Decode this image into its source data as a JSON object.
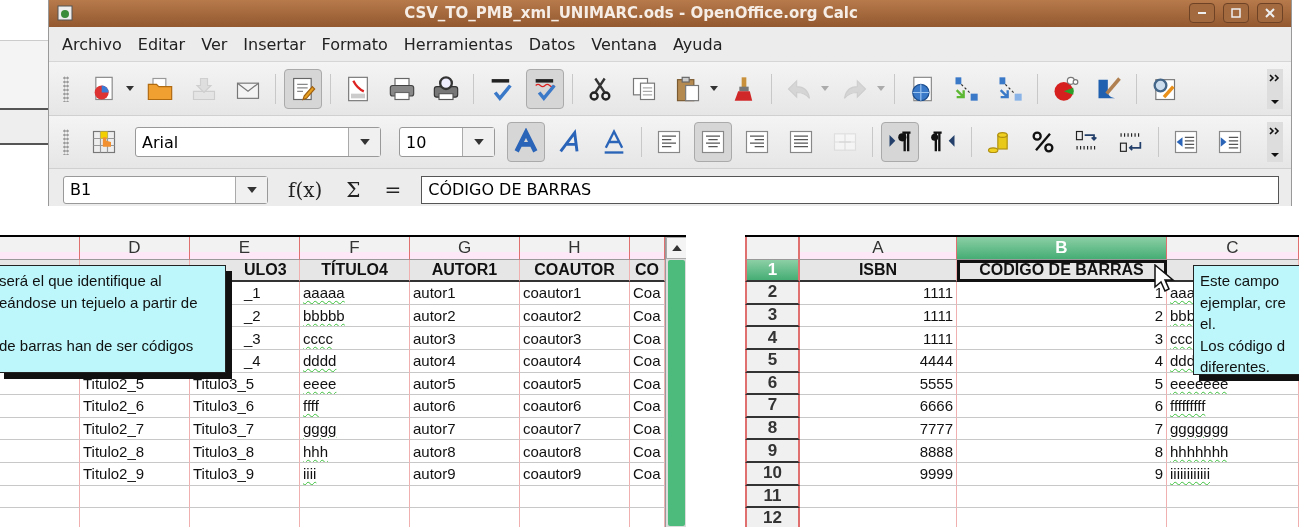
{
  "window": {
    "title": "CSV_TO_PMB_xml_UNIMARC.ods - OpenOffice.org Calc"
  },
  "menu": [
    "Archivo",
    "Editar",
    "Ver",
    "Insertar",
    "Formato",
    "Herramientas",
    "Datos",
    "Ventana",
    "Ayuda"
  ],
  "toolbar_standard": {
    "groups": [
      [
        {
          "kind": "new",
          "pressed": false,
          "disabled": false
        },
        {
          "kind": "dropdown",
          "pressed": false,
          "disabled": false
        },
        {
          "kind": "open",
          "pressed": false,
          "disabled": false
        },
        {
          "kind": "save",
          "pressed": false,
          "disabled": true
        },
        {
          "kind": "email",
          "pressed": false,
          "disabled": false
        }
      ],
      [
        {
          "kind": "edit",
          "pressed": true,
          "disabled": false
        }
      ],
      [
        {
          "kind": "pdf",
          "pressed": false,
          "disabled": false
        },
        {
          "kind": "print",
          "pressed": false,
          "disabled": false
        },
        {
          "kind": "preview",
          "pressed": false,
          "disabled": false
        }
      ],
      [
        {
          "kind": "spellcheck",
          "pressed": false,
          "disabled": false
        },
        {
          "kind": "autospell",
          "pressed": true,
          "disabled": false
        }
      ],
      [
        {
          "kind": "cut",
          "pressed": false,
          "disabled": false
        },
        {
          "kind": "copy",
          "pressed": false,
          "disabled": false
        },
        {
          "kind": "paste",
          "pressed": false,
          "disabled": false
        },
        {
          "kind": "dropdown",
          "pressed": false,
          "disabled": false
        },
        {
          "kind": "clone",
          "pressed": false,
          "disabled": false
        }
      ],
      [
        {
          "kind": "undo",
          "pressed": false,
          "disabled": true
        },
        {
          "kind": "dropdown",
          "pressed": false,
          "disabled": true
        },
        {
          "kind": "redo",
          "pressed": false,
          "disabled": true
        },
        {
          "kind": "dropdown",
          "pressed": false,
          "disabled": true
        }
      ],
      [
        {
          "kind": "hyperlink",
          "pressed": false,
          "disabled": false
        },
        {
          "kind": "sort_asc",
          "pressed": false,
          "disabled": false
        },
        {
          "kind": "sort_desc",
          "pressed": false,
          "disabled": false
        }
      ],
      [
        {
          "kind": "chart",
          "pressed": false,
          "disabled": false
        },
        {
          "kind": "draw",
          "pressed": false,
          "disabled": false
        }
      ],
      [
        {
          "kind": "find",
          "pressed": false,
          "disabled": false
        }
      ]
    ]
  },
  "toolbar_formatting": {
    "groups": [
      [
        {
          "kind": "styles",
          "pressed": false,
          "disabled": false
        },
        {
          "kind": "font_name",
          "value": "Arial"
        },
        {
          "kind": "font_size",
          "value": "10"
        },
        {
          "kind": "bold",
          "pressed": true,
          "disabled": false
        },
        {
          "kind": "italic",
          "pressed": false,
          "disabled": false
        },
        {
          "kind": "underline",
          "pressed": false,
          "disabled": false
        }
      ],
      [
        {
          "kind": "align_left",
          "pressed": false,
          "disabled": false
        },
        {
          "kind": "align_center",
          "pressed": true,
          "disabled": false
        },
        {
          "kind": "align_right",
          "pressed": false,
          "disabled": false
        },
        {
          "kind": "justify",
          "pressed": false,
          "disabled": false
        },
        {
          "kind": "merge",
          "pressed": false,
          "disabled": true
        }
      ],
      [
        {
          "kind": "ltr",
          "pressed": true,
          "disabled": false
        },
        {
          "kind": "rtl",
          "pressed": false,
          "disabled": false
        }
      ],
      [
        {
          "kind": "currency",
          "pressed": false,
          "disabled": false
        },
        {
          "kind": "percent",
          "pressed": false,
          "disabled": false
        },
        {
          "kind": "add_decimal",
          "pressed": false,
          "disabled": false
        },
        {
          "kind": "del_decimal",
          "pressed": false,
          "disabled": false
        }
      ],
      [
        {
          "kind": "indent_less",
          "pressed": false,
          "disabled": false
        },
        {
          "kind": "indent_more",
          "pressed": false,
          "disabled": false
        }
      ]
    ]
  },
  "formula_bar": {
    "name_box": "B1",
    "buttons": [
      "f(x)",
      "Σ",
      "="
    ],
    "content": "CÓDIGO DE BARRAS"
  },
  "left_sheet": {
    "columns": [
      {
        "selected": false
      },
      {
        "label": "D",
        "selected": false
      },
      {
        "label": "E",
        "selected": false
      },
      {
        "label": "F",
        "selected": false,
        "spell_marked": true
      },
      {
        "label": "G",
        "selected": false
      },
      {
        "label": "H",
        "selected": false
      },
      {
        "selected": false
      }
    ],
    "rows": [
      {
        "kind": "header",
        "cells": [
          null,
          null,
          {
            "text": "ULO3",
            "covered": true
          },
          "TÍTULO4",
          "AUTOR1",
          "COAUTOR",
          "CO"
        ]
      },
      {
        "kind": "data",
        "cells": [
          null,
          null,
          {
            "text": "_1",
            "covered": true
          },
          "aaaaa",
          "autor1",
          "coautor1",
          "Coa"
        ]
      },
      {
        "kind": "data",
        "cells": [
          null,
          null,
          {
            "text": "_2",
            "covered": true
          },
          "bbbbb",
          "autor2",
          "coautor2",
          "Coa"
        ]
      },
      {
        "kind": "data",
        "cells": [
          null,
          null,
          {
            "text": "_3",
            "covered": true
          },
          "cccc",
          "autor3",
          "coautor3",
          "Coa"
        ]
      },
      {
        "kind": "data",
        "cells": [
          null,
          null,
          {
            "text": "_4",
            "covered": true
          },
          "dddd",
          "autor4",
          "coautor4",
          "Coa"
        ]
      },
      {
        "kind": "data",
        "cells": [
          null,
          "Titulo2_5",
          "Titulo3_5",
          "eeee",
          "autor5",
          "coautor5",
          "Coa"
        ]
      },
      {
        "kind": "data",
        "cells": [
          null,
          "Titulo2_6",
          "Titulo3_6",
          "ffff",
          "autor6",
          "coautor6",
          "Coa"
        ]
      },
      {
        "kind": "data",
        "cells": [
          null,
          "Titulo2_7",
          "Titulo3_7",
          "gggg",
          "autor7",
          "coautor7",
          "Coa"
        ]
      },
      {
        "kind": "data",
        "cells": [
          null,
          "Titulo2_8",
          "Titulo3_8",
          "hhh",
          "autor8",
          "coautor8",
          "Coa"
        ]
      },
      {
        "kind": "data",
        "cells": [
          null,
          "Titulo2_9",
          "Titulo3_9",
          "iiii",
          "autor9",
          "coautor9",
          "Coa"
        ]
      }
    ],
    "comment": "será el que identifique al\neándose un tejuelo a partir de\n\nde barras han de ser códigos"
  },
  "right_sheet": {
    "columns": [
      {
        "label": "A",
        "selected": false,
        "kind": "number"
      },
      {
        "label": "B",
        "selected": true,
        "kind": "number"
      },
      {
        "label": "C",
        "selected": false,
        "kind": "text",
        "spell_marked": true
      }
    ],
    "rows": [
      {
        "number": "1",
        "selected": true,
        "kind": "header",
        "cells": [
          "ISBN",
          {
            "text": "CÓDIGO DE BARRAS",
            "active": true
          },
          null
        ]
      },
      {
        "number": "2",
        "selected": false,
        "kind": "data",
        "cells": [
          "1111",
          "1",
          "aaa"
        ]
      },
      {
        "number": "3",
        "selected": false,
        "kind": "data",
        "cells": [
          "1111",
          "2",
          "bbb"
        ]
      },
      {
        "number": "4",
        "selected": false,
        "kind": "data",
        "cells": [
          "1111",
          "3",
          "ccc"
        ]
      },
      {
        "number": "5",
        "selected": false,
        "kind": "data",
        "cells": [
          "4444",
          "4",
          "ddd"
        ]
      },
      {
        "number": "6",
        "selected": false,
        "kind": "data",
        "cells": [
          "5555",
          "5",
          "eeeeeee"
        ]
      },
      {
        "number": "7",
        "selected": false,
        "kind": "data",
        "cells": [
          "6666",
          "6",
          "fffffffff"
        ]
      },
      {
        "number": "8",
        "selected": false,
        "kind": "data",
        "cells": [
          "7777",
          "7",
          "ggggggg"
        ]
      },
      {
        "number": "9",
        "selected": false,
        "kind": "data",
        "cells": [
          "8888",
          "8",
          "hhhhhhh"
        ]
      },
      {
        "number": "10",
        "selected": false,
        "kind": "data",
        "cells": [
          "9999",
          "9",
          "iiiiiiiiiiii"
        ]
      },
      {
        "number": "11",
        "selected": false,
        "kind": "data"
      },
      {
        "number": "12",
        "selected": false,
        "kind": "data"
      }
    ],
    "comment": "Este campo\nejemplar, cre\nel.\nLos código d\ndiferentes."
  }
}
